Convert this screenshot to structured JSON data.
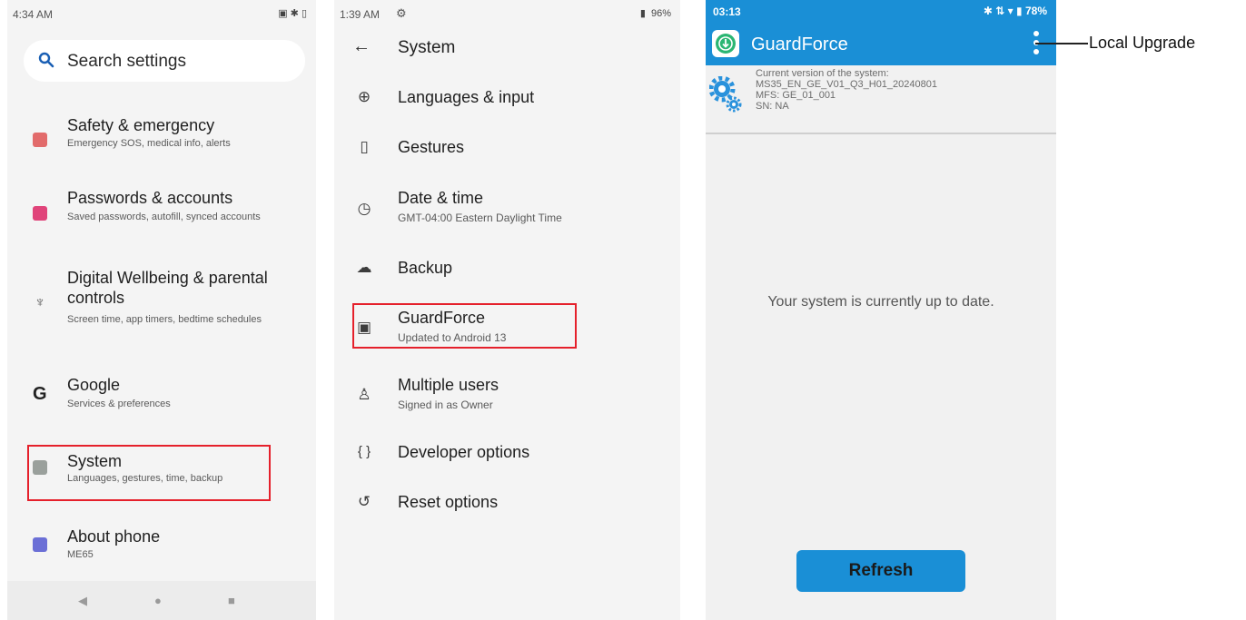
{
  "panel1": {
    "time": "4:34 AM",
    "status_icons": "▣ ✱ ▯",
    "search_placeholder": "Search settings",
    "items": [
      {
        "title": "Safety & emergency",
        "subtitle": "Emergency SOS, medical info, alerts",
        "icon": "safety-icon",
        "color": "#e26b6b"
      },
      {
        "title": "Passwords & accounts",
        "subtitle": "Saved passwords, autofill, synced accounts",
        "icon": "passwords-icon",
        "color": "#e0447a"
      },
      {
        "title": "Digital Wellbeing & parental controls",
        "subtitle": "Screen time, app timers, bedtime schedules",
        "icon": "wellbeing-icon",
        "color": "#555555"
      },
      {
        "title": "Google",
        "subtitle": "Services & preferences",
        "icon": "google-icon",
        "color": "#222222"
      },
      {
        "title": "System",
        "subtitle": "Languages, gestures, time, backup",
        "icon": "system-icon",
        "color": "#9aa09c"
      },
      {
        "title": "About phone",
        "subtitle": "ME65",
        "icon": "about-phone-icon",
        "color": "#6b6fd6"
      }
    ],
    "nav": {
      "back": "◀",
      "home": "●",
      "recents": "■"
    }
  },
  "panel2": {
    "time": "1:39 AM",
    "battery": "96%",
    "header_title": "System",
    "items": [
      {
        "title": "Languages & input",
        "subtitle": "",
        "icon": "globe-icon",
        "glyph": "⊕"
      },
      {
        "title": "Gestures",
        "subtitle": "",
        "icon": "gestures-icon",
        "glyph": "▯"
      },
      {
        "title": "Date & time",
        "subtitle": "GMT-04:00 Eastern Daylight Time",
        "icon": "clock-icon",
        "glyph": "◷"
      },
      {
        "title": "Backup",
        "subtitle": "",
        "icon": "backup-icon",
        "glyph": "☁"
      },
      {
        "title": "GuardForce",
        "subtitle": "Updated to Android 13",
        "icon": "guardforce-icon",
        "glyph": "▣"
      },
      {
        "title": "Multiple users",
        "subtitle": "Signed in as Owner",
        "icon": "users-icon",
        "glyph": "♙"
      },
      {
        "title": "Developer options",
        "subtitle": "",
        "icon": "developer-icon",
        "glyph": "{ }"
      },
      {
        "title": "Reset options",
        "subtitle": "",
        "icon": "reset-icon",
        "glyph": "↺"
      }
    ]
  },
  "panel3": {
    "time": "03:13",
    "status": "✱ ⇅ ▾ ▮ 78%",
    "app_title": "GuardForce",
    "version_lines": [
      "Current version of the system:",
      "MS35_EN_GE_V01_Q3_H01_20240801",
      "MFS: GE_01_001",
      "SN: NA"
    ],
    "message": "Your system is currently up to date.",
    "refresh_label": "Refresh",
    "callout": "Local Upgrade"
  },
  "colors": {
    "highlight": "#e5202b",
    "app_blue": "#1a8fd6"
  }
}
